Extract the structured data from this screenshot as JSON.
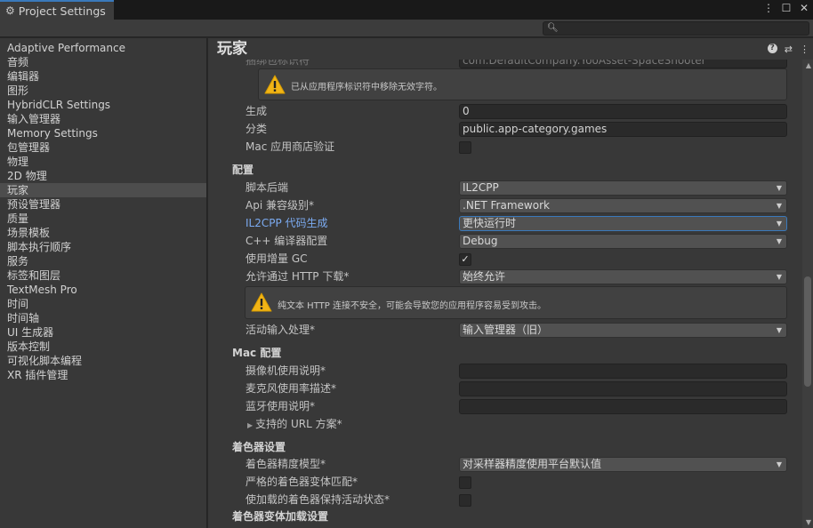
{
  "window": {
    "tab_title": "Project Settings",
    "icons": [
      "gear-icon",
      "more-icon",
      "maximize-icon",
      "close-icon"
    ]
  },
  "search": {
    "placeholder": ""
  },
  "sidebar": {
    "items": [
      {
        "label": "Adaptive Performance"
      },
      {
        "label": "音频"
      },
      {
        "label": "编辑器"
      },
      {
        "label": "图形"
      },
      {
        "label": "HybridCLR Settings"
      },
      {
        "label": "输入管理器"
      },
      {
        "label": "Memory Settings"
      },
      {
        "label": "包管理器"
      },
      {
        "label": "物理"
      },
      {
        "label": "2D 物理"
      },
      {
        "label": "玩家",
        "active": true
      },
      {
        "label": "预设管理器"
      },
      {
        "label": "质量"
      },
      {
        "label": "场景模板"
      },
      {
        "label": "脚本执行顺序"
      },
      {
        "label": "服务"
      },
      {
        "label": "标签和图层"
      },
      {
        "label": "TextMesh Pro"
      },
      {
        "label": "时间"
      },
      {
        "label": "时间轴"
      },
      {
        "label": "UI 生成器"
      },
      {
        "label": "版本控制"
      },
      {
        "label": "可视化脚本编程"
      },
      {
        "label": "XR 插件管理"
      }
    ]
  },
  "main": {
    "title": "玩家",
    "bundle_id": {
      "label": "捆绑包标识符",
      "value": "com.DefaultCompany.YooAsset-SpaceShooter"
    },
    "bundle_warning": "已从应用程序标识符中移除无效字符。",
    "build": {
      "label": "生成",
      "value": "0"
    },
    "category": {
      "label": "分类",
      "value": "public.app-category.games"
    },
    "mac_store_validation": {
      "label": "Mac 应用商店验证",
      "checked": false
    },
    "config_section": "配置",
    "scripting_backend": {
      "label": "脚本后端",
      "value": "IL2CPP"
    },
    "api_compat": {
      "label": "Api 兼容级别*",
      "value": ".NET Framework"
    },
    "il2cpp_codegen": {
      "label": "IL2CPP 代码生成",
      "value": "更快运行时"
    },
    "cpp_compiler": {
      "label": "C++ 编译器配置",
      "value": "Debug"
    },
    "incremental_gc": {
      "label": "使用增量 GC",
      "checked": true
    },
    "http_download": {
      "label": "允许通过 HTTP 下载*",
      "value": "始终允许"
    },
    "http_warning": "纯文本 HTTP 连接不安全，可能会导致您的应用程序容易受到攻击。",
    "active_input": {
      "label": "活动输入处理*",
      "value": "输入管理器（旧）"
    },
    "mac_section": "Mac 配置",
    "camera_usage": {
      "label": "摄像机使用说明*",
      "value": ""
    },
    "mic_usage": {
      "label": "麦克风使用率描述*",
      "value": ""
    },
    "bluetooth_usage": {
      "label": "蓝牙使用说明*",
      "value": ""
    },
    "url_schemes": {
      "label": "支持的 URL 方案*"
    },
    "shader_section": "着色器设置",
    "shader_precision": {
      "label": "着色器精度模型*",
      "value": "对采样器精度使用平台默认值"
    },
    "strict_variant": {
      "label": "严格的着色器变体匹配*",
      "checked": false
    },
    "keep_loaded_shaders": {
      "label": "使加载的着色器保持活动状态*",
      "checked": false
    },
    "variant_loading_section": "着色器变体加载设置"
  }
}
